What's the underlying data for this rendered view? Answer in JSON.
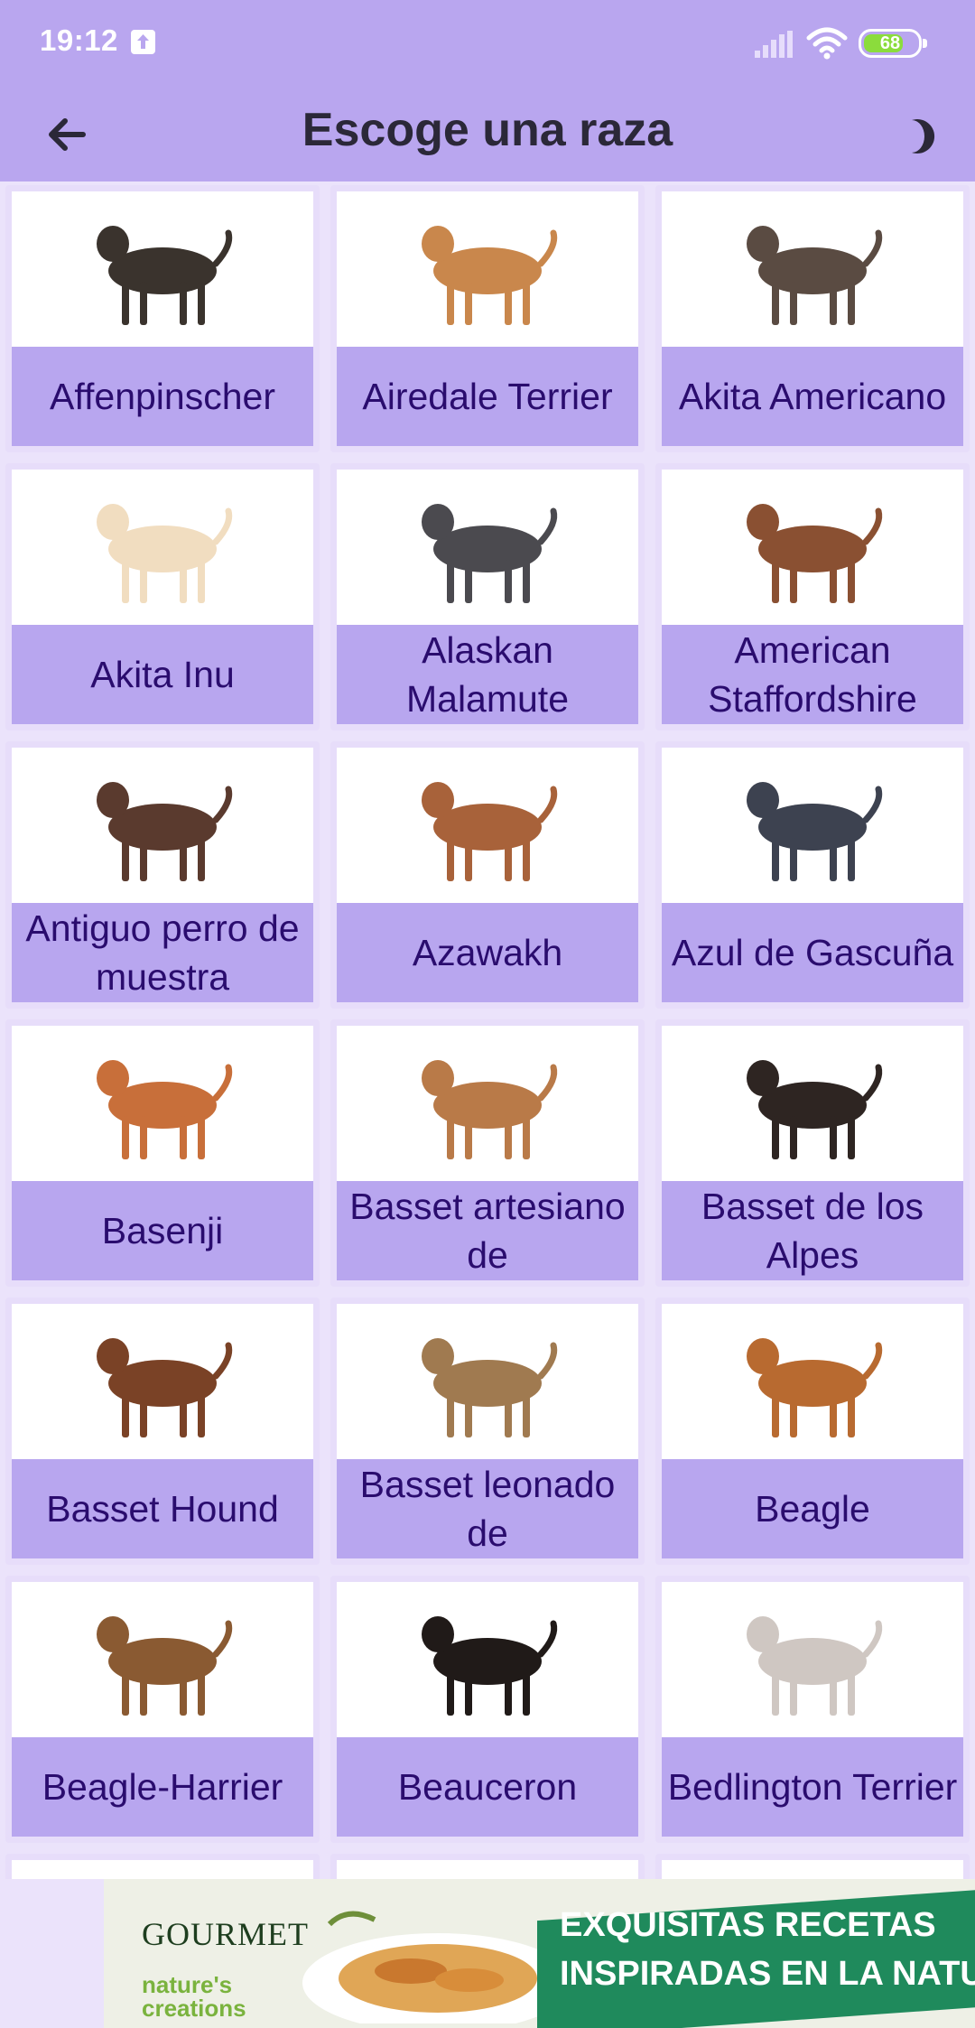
{
  "status_bar": {
    "time": "19:12",
    "battery_level": "68"
  },
  "app_bar": {
    "title": "Escoge una raza"
  },
  "breeds": [
    {
      "name": "Affenpinscher",
      "color": "#3a332d"
    },
    {
      "name": "Airedale Terrier",
      "color": "#c9874c"
    },
    {
      "name": "Akita Americano",
      "color": "#5a4b42"
    },
    {
      "name": "Akita Inu",
      "color": "#f1ddc0"
    },
    {
      "name": "Alaskan Malamute",
      "color": "#4b4a4f"
    },
    {
      "name": "American Staffordshire",
      "color": "#8a5032"
    },
    {
      "name": "Antiguo perro de muestra",
      "color": "#5a3a2e"
    },
    {
      "name": "Azawakh",
      "color": "#a8623a"
    },
    {
      "name": "Azul de Gascuña",
      "color": "#3d4250"
    },
    {
      "name": "Basenji",
      "color": "#c86f3a"
    },
    {
      "name": "Basset artesiano de",
      "color": "#b97a48"
    },
    {
      "name": "Basset de los Alpes",
      "color": "#2e2522"
    },
    {
      "name": "Basset Hound",
      "color": "#7a4226"
    },
    {
      "name": "Basset leonado de",
      "color": "#a07a50"
    },
    {
      "name": "Beagle",
      "color": "#b86a30"
    },
    {
      "name": "Beagle-Harrier",
      "color": "#8a5a32"
    },
    {
      "name": "Beauceron",
      "color": "#201a18"
    },
    {
      "name": "Bedlington Terrier",
      "color": "#cfc7c2"
    },
    {
      "name": "",
      "color": "#5a5a5a"
    },
    {
      "name": "",
      "color": "#cccccc"
    },
    {
      "name": "",
      "color": "#dddddd"
    }
  ],
  "ad": {
    "brand": "GOURMET",
    "subbrand": "nature's creations",
    "headline_line1": "EXQUISITAS RECETAS",
    "headline_line2": "INSPIRADAS EN LA NATURAL"
  }
}
